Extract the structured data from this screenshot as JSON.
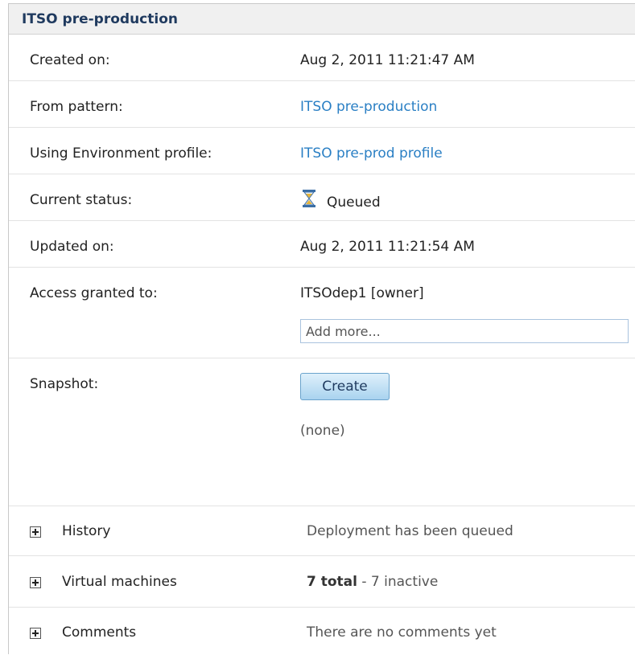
{
  "panel": {
    "title": "ITSO pre-production"
  },
  "details": {
    "created_on": {
      "label": "Created on:",
      "value": "Aug 2, 2011 11:21:47 AM"
    },
    "from_pattern": {
      "label": "From pattern:",
      "value": "ITSO pre-production"
    },
    "env_profile": {
      "label": "Using Environment profile:",
      "value": "ITSO pre-prod profile"
    },
    "status": {
      "label": "Current status:",
      "value": "Queued",
      "icon": "hourglass-icon"
    },
    "updated_on": {
      "label": "Updated on:",
      "value": "Aug 2, 2011 11:21:54 AM"
    },
    "access": {
      "label": "Access granted to:",
      "value": "ITSOdep1 [owner]",
      "placeholder": "Add more..."
    },
    "snapshot": {
      "label": "Snapshot:",
      "button_label": "Create",
      "value": "(none)"
    }
  },
  "sections": {
    "history": {
      "label": "History",
      "summary": "Deployment has been queued"
    },
    "virtual_machines": {
      "label": "Virtual machines",
      "total": "7 total",
      "summary": " - 7 inactive"
    },
    "comments": {
      "label": "Comments",
      "summary": "There are no comments yet"
    }
  },
  "colors": {
    "link": "#2a7fc4",
    "title": "#1f3a5f",
    "button": "#a9d3ef"
  }
}
